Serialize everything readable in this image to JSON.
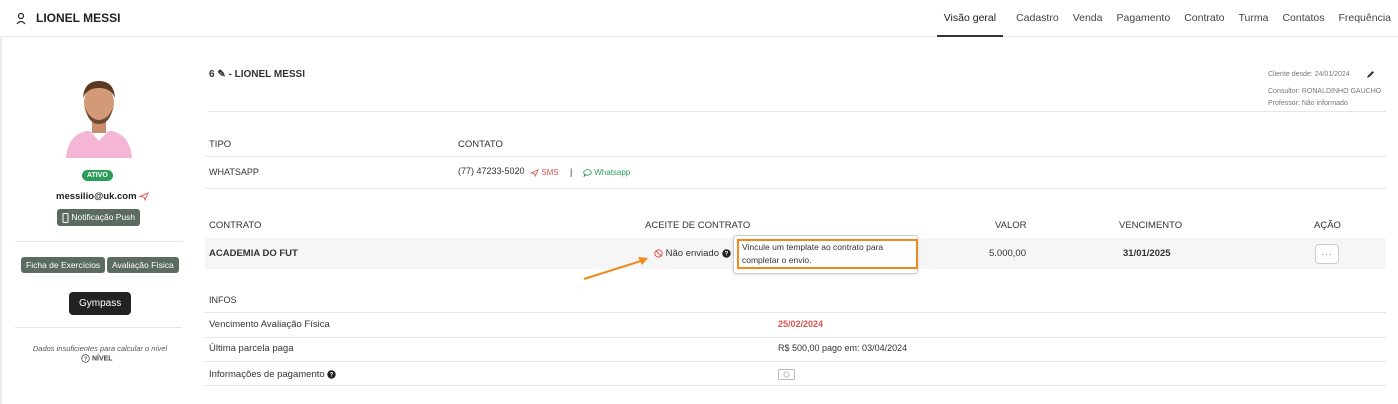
{
  "header": {
    "client_name": "LIONEL MESSI",
    "tabs": [
      {
        "label": "Visão geral",
        "active": true
      },
      {
        "label": "Cadastro",
        "active": false
      },
      {
        "label": "Venda",
        "active": false
      },
      {
        "label": "Pagamento",
        "active": false
      },
      {
        "label": "Contrato",
        "active": false
      },
      {
        "label": "Turma",
        "active": false
      },
      {
        "label": "Contatos",
        "active": false
      },
      {
        "label": "Frequência",
        "active": false
      }
    ]
  },
  "sidebar": {
    "status_badge": "ATIVO",
    "email": "messilio@uk.com",
    "push_button": "Notificação Push",
    "ficha_button": "Ficha de Exercícios",
    "avaliacao_button": "Avaliação Física",
    "gympass_button": "Gympass",
    "nivel_message": "Dados insuficientes para calcular o nível",
    "nivel_label": "NÍVEL"
  },
  "client": {
    "heading": "6 ✎ - LIONEL MESSI",
    "cliente_desde": "Cliente desde: 24/01/2024",
    "consultor": "Consultor: RONALDINHO GAUCHO",
    "professor": "Professor: Não informado"
  },
  "contacts": {
    "headers": {
      "tipo": "TIPO",
      "contato": "CONTATO"
    },
    "row": {
      "tipo": "WHATSAPP",
      "numero": "(77) 47233-5020",
      "sms": "SMS",
      "separator": "|",
      "whatsapp": "Whatsapp"
    }
  },
  "contracts": {
    "headers": {
      "contrato": "CONTRATO",
      "aceite": "ACEITE DE CONTRATO",
      "valor": "VALOR",
      "vencimento": "VENCIMENTO",
      "acao": "AÇÃO"
    },
    "row": {
      "contrato": "ACADEMIA DO FUT",
      "aceite": "Não enviado",
      "valor": "5.000,00",
      "vencimento": "31/01/2025",
      "acao": "···"
    },
    "tooltip": "Vincule um template ao contrato para completar o envio."
  },
  "infos": {
    "title": "INFOS",
    "rows": [
      {
        "label": "Vencimento Avaliação Física",
        "value": "25/02/2024"
      },
      {
        "label": "Última parcela paga",
        "value": "R$ 500,00 pago em: 03/04/2024"
      },
      {
        "label": "Informações de pagamento",
        "value": ""
      }
    ]
  },
  "colors": {
    "accent_red": "#d9534f",
    "whatsapp_green": "#2b9f5a",
    "highlight_orange": "#f08a1c",
    "status_green": "#2b9f5a"
  }
}
